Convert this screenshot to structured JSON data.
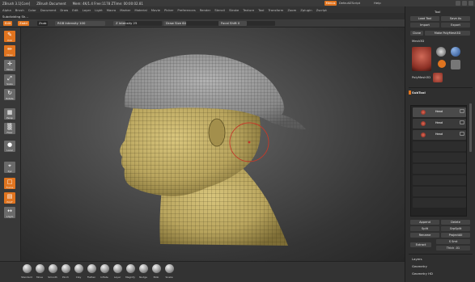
{
  "titlebar": {
    "app": "ZBrush 3.1[Core]",
    "doc": "ZBrush Document",
    "mem": "Mem: 4K/1.4 Free:1178 ZTime: 00:00:02.81",
    "menus_label": "Menus",
    "script_label": "DefaultZScript",
    "help_label": "Help"
  },
  "menubar": [
    "Alpha",
    "Brush",
    "Color",
    "Document",
    "Draw",
    "Edit",
    "Layer",
    "Light",
    "Macro",
    "Marker",
    "Material",
    "Movie",
    "Picker",
    "Preferences",
    "Render",
    "Stencil",
    "Stroke",
    "Texture",
    "Tool",
    "Transform",
    "Zoom",
    "Zplugin",
    "Zscript"
  ],
  "inforow": {
    "label": "Subdividing Sh..."
  },
  "shelf": {
    "edit_label": "Edit",
    "draw_label": "Zadd",
    "zsub_label": "Zsub",
    "rgb_intensity": "RGB Intensity 100",
    "z_intensity": "Z Intensity 25",
    "draw_size": "Draw Size 64",
    "focal_shift": "Focal Shift 0",
    "rgb_intensity_fill": 1.0,
    "z_intensity_fill": 0.25,
    "draw_size_fill": 0.4,
    "focal_shift_fill": 0.5
  },
  "leftshelf": {
    "buttons": [
      {
        "name": "edit",
        "label": "Edit",
        "glyph": "✎",
        "style": "orange"
      },
      {
        "name": "draw",
        "label": "Draw",
        "glyph": "✏",
        "style": "orange"
      },
      {
        "name": "move",
        "label": "Move",
        "glyph": "✛",
        "style": "gray"
      },
      {
        "name": "scale",
        "label": "Scale",
        "glyph": "⤢",
        "style": "gray"
      },
      {
        "name": "rotate",
        "label": "Rotate",
        "glyph": "↻",
        "style": "gray"
      },
      {
        "name": "persp",
        "label": "Persp",
        "glyph": "▦",
        "style": "gray"
      },
      {
        "name": "floor",
        "label": "Floor",
        "glyph": "▒",
        "style": "gray"
      },
      {
        "name": "local",
        "label": "Local",
        "glyph": "●",
        "style": "gray"
      },
      {
        "name": "xyz",
        "label": "Xyz",
        "glyph": "⌖",
        "style": "gray"
      },
      {
        "name": "frame",
        "label": "Frame",
        "glyph": "□",
        "style": "orange"
      },
      {
        "name": "polyf",
        "label": "PolyF",
        "glyph": "▤",
        "style": "orange"
      },
      {
        "name": "lsym",
        "label": "L.Sym",
        "glyph": "↔",
        "style": "gray"
      }
    ]
  },
  "brushes": [
    "Standard",
    "Move",
    "Smooth",
    "Pinch",
    "Clay",
    "Flatten",
    "Inflate",
    "Layer",
    "Magnify",
    "Nudge",
    "Blob",
    "Snake"
  ],
  "righttray": {
    "header": "Tool",
    "load_label": "Load Tool",
    "save_label": "Save As",
    "import_label": "Import",
    "export_label": "Export",
    "clone_label": "Clone",
    "make_poly_label": "Make PolyMesh3D",
    "mesh_label": "Mesh3D",
    "polymesh_label": "PolyMesh3D",
    "subtool_title": "SubTool",
    "subtools": [
      "Head",
      "Head",
      "Head"
    ],
    "append_label": "Append",
    "delete_label": "Delete",
    "split_label": "Split",
    "grpsplit_label": "GrpSplit",
    "rename_label": "Rename",
    "projectall_label": "ProjectAll",
    "extract_label": "Extract",
    "smt_label": "S Smt",
    "thick_label": "Thick .01",
    "layers_label": "Layers",
    "geometry_label": "Geometry",
    "geometry_hd_label": "Geometry HD"
  },
  "colors": {
    "accent": "#e0741f",
    "skin": "#c9b56a",
    "cap": "#8c8c8c"
  }
}
